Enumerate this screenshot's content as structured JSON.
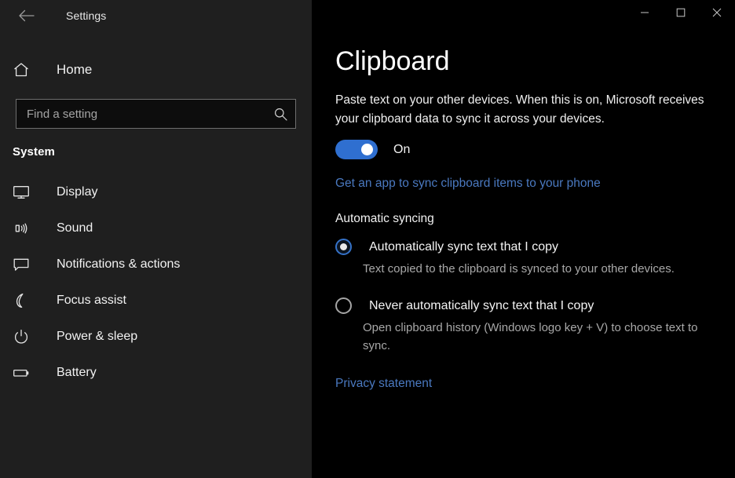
{
  "window": {
    "app_title": "Settings",
    "back_icon": "back-arrow-icon",
    "controls": {
      "minimize": "minimize-icon",
      "maximize": "maximize-icon",
      "close": "close-icon"
    }
  },
  "sidebar": {
    "home": {
      "label": "Home",
      "icon": "home-icon"
    },
    "search": {
      "value": "",
      "placeholder": "Find a setting",
      "icon": "search-icon"
    },
    "group_label": "System",
    "items": [
      {
        "label": "Display",
        "icon": "monitor-icon"
      },
      {
        "label": "Sound",
        "icon": "speaker-icon"
      },
      {
        "label": "Notifications & actions",
        "icon": "chat-bubble-icon"
      },
      {
        "label": "Focus assist",
        "icon": "crescent-moon-icon"
      },
      {
        "label": "Power & sleep",
        "icon": "power-icon"
      },
      {
        "label": "Battery",
        "icon": "battery-icon"
      }
    ]
  },
  "main": {
    "title": "Clipboard",
    "description": "Paste text on your other devices. When this is on, Microsoft receives your clipboard data to sync it across your devices.",
    "toggle": {
      "state_label": "On",
      "checked": true
    },
    "app_link": "Get an app to sync clipboard items to your phone",
    "section_heading": "Automatic syncing",
    "options": [
      {
        "label": "Automatically sync text that I copy",
        "description": "Text copied to the clipboard is synced to your other devices.",
        "selected": true
      },
      {
        "label": "Never automatically sync text that I copy",
        "description": "Open clipboard history (Windows logo key + V) to choose text to sync.",
        "selected": false
      }
    ],
    "privacy_link": "Privacy statement"
  },
  "colors": {
    "accent": "#2f6fd0",
    "link": "#4a79c0",
    "sidebar_bg": "#1f1f1f",
    "main_bg": "#000000"
  }
}
